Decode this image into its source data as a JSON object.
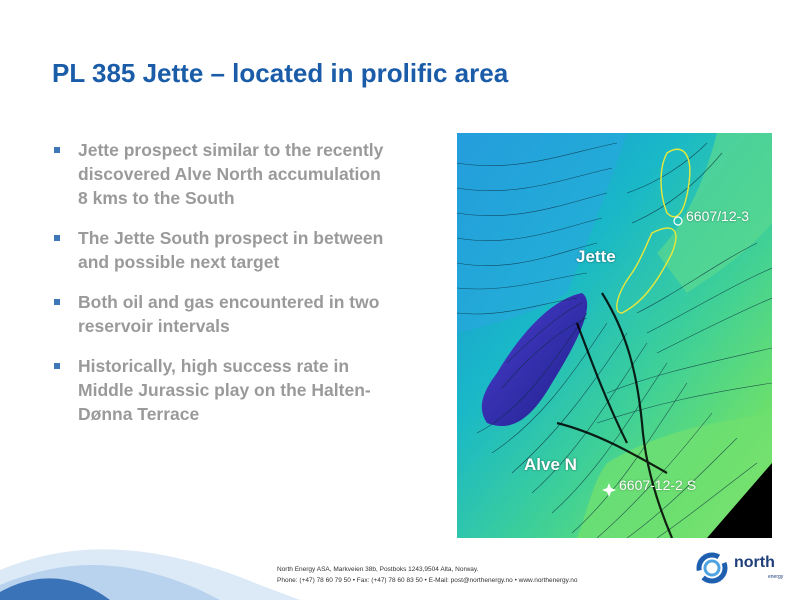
{
  "slide": {
    "title": "PL 385 Jette – located in prolific area",
    "bullets": [
      "Jette prospect similar to the recently discovered Alve North accumulation 8 kms to the South",
      "The Jette South prospect in between and possible next target",
      "Both oil and gas encountered in two reservoir intervals",
      "Historically, high success rate in Middle Jurassic play on the Halten-Dønna Terrace"
    ]
  },
  "map": {
    "labels": {
      "jette": "Jette",
      "alve_n": "Alve N",
      "well_1": "6607/12-3",
      "well_2": "6607-12-2 S"
    },
    "colors": {
      "deep": "#3b2fb0",
      "mid": "#19b8c8",
      "shallow": "#5be07a",
      "high": "#b7f06a"
    }
  },
  "footer": {
    "line1": "North Energy ASA, Markveien 38b, Postboks 1243,9504 Alta, Norway.",
    "line2": "Phone: (+47) 78 60 79 50 • Fax: (+47) 78 60 83 50 • E-Mail: post@northenergy.no • www.northenergy.no"
  },
  "logo": {
    "name": "north",
    "sub": "energy"
  }
}
